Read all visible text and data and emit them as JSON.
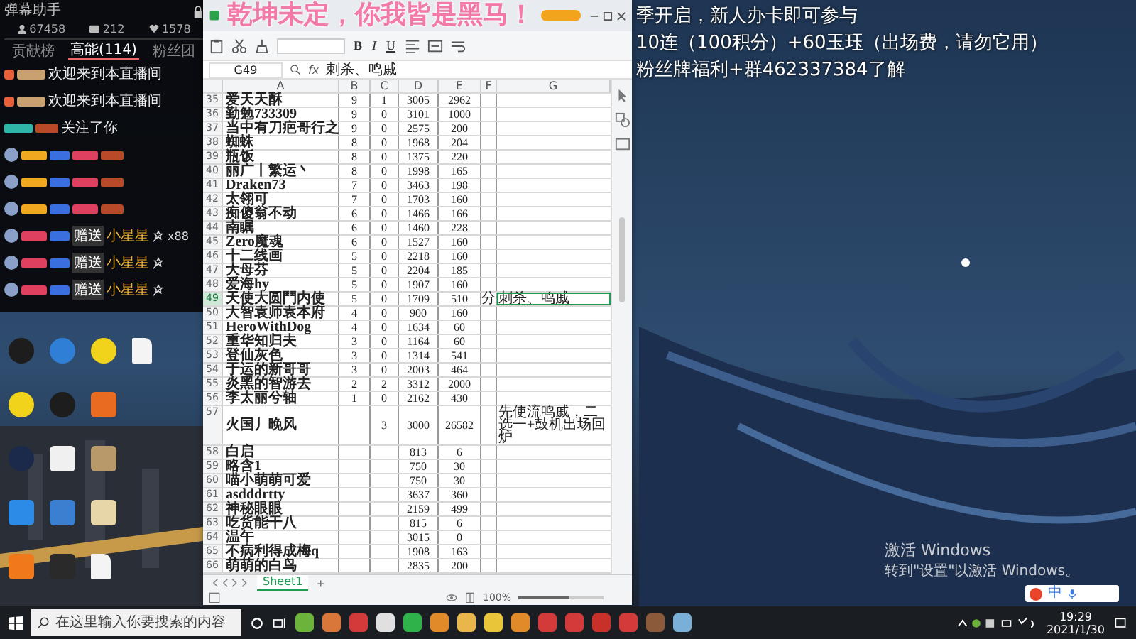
{
  "overlay": {
    "headline": "乾坤未定，你我皆是黑马！",
    "notice_lines": [
      "季开启，新人办卡即可参与",
      "10连（100积分）+60玉珏（出场费，请勿它用）",
      "粉丝牌福利+群462337384了解"
    ]
  },
  "chat": {
    "title": "弹幕助手",
    "stats": [
      {
        "kind": "viewers",
        "value": "67458"
      },
      {
        "kind": "members",
        "value": "212"
      },
      {
        "kind": "likes",
        "value": "1578"
      }
    ],
    "tabs": [
      {
        "label": "贡献榜",
        "selected": false
      },
      {
        "label": "高能(114)",
        "selected": true
      },
      {
        "label": "粉丝团",
        "selected": false
      }
    ],
    "messages": [
      {
        "kind": "welcome",
        "text": "欢迎来到本直播间"
      },
      {
        "kind": "welcome",
        "text": "欢迎来到本直播间"
      },
      {
        "kind": "follow",
        "text": "关注了你"
      },
      {
        "kind": "chat"
      },
      {
        "kind": "chat"
      },
      {
        "kind": "chat"
      },
      {
        "kind": "gift",
        "action": "赠送",
        "item": "小星星",
        "count": "x88"
      },
      {
        "kind": "gift",
        "action": "赠送",
        "item": "小星星"
      },
      {
        "kind": "gift",
        "action": "赠送",
        "item": "小星星"
      }
    ]
  },
  "spreadsheet": {
    "format_buttons": [
      "B",
      "I",
      "U"
    ],
    "name_box": "G49",
    "fx": "fx",
    "formula": "刺杀、鸣戚",
    "columns": [
      "A",
      "B",
      "C",
      "D",
      "E",
      "F",
      "G"
    ],
    "rows": [
      {
        "n": "35",
        "a": "爱天天酥",
        "b": "9",
        "c": "1",
        "d": "3005",
        "e": "2962",
        "selected": false
      },
      {
        "n": "36",
        "a": "勤勉733309",
        "b": "9",
        "c": "0",
        "d": "3101",
        "e": "1000",
        "selected": false
      },
      {
        "n": "37",
        "a": "当中有刀疤哥行之",
        "b": "9",
        "c": "0",
        "d": "2575",
        "e": "200",
        "selected": false
      },
      {
        "n": "38",
        "a": "蜘蛛",
        "b": "8",
        "c": "0",
        "d": "1968",
        "e": "204",
        "selected": false
      },
      {
        "n": "39",
        "a": "瓶饭",
        "b": "8",
        "c": "0",
        "d": "1375",
        "e": "220",
        "selected": false
      },
      {
        "n": "40",
        "a": "丽广丨繁运丶",
        "b": "8",
        "c": "0",
        "d": "1998",
        "e": "165",
        "selected": false
      },
      {
        "n": "41",
        "a": "Draken73",
        "b": "7",
        "c": "0",
        "d": "3463",
        "e": "198",
        "selected": false
      },
      {
        "n": "42",
        "a": "太翎可",
        "b": "7",
        "c": "0",
        "d": "1703",
        "e": "160",
        "selected": false
      },
      {
        "n": "43",
        "a": "痴傻翁不动",
        "b": "6",
        "c": "0",
        "d": "1466",
        "e": "166",
        "selected": false
      },
      {
        "n": "44",
        "a": "南瞩",
        "b": "6",
        "c": "0",
        "d": "1460",
        "e": "228",
        "selected": false
      },
      {
        "n": "45",
        "a": "Zero魔魂",
        "b": "6",
        "c": "0",
        "d": "1527",
        "e": "160",
        "selected": false
      },
      {
        "n": "46",
        "a": "十二线画",
        "b": "5",
        "c": "0",
        "d": "2218",
        "e": "160",
        "selected": false
      },
      {
        "n": "47",
        "a": "大母芬",
        "b": "5",
        "c": "0",
        "d": "2204",
        "e": "185",
        "selected": false
      },
      {
        "n": "48",
        "a": "爱海hy",
        "b": "5",
        "c": "0",
        "d": "1907",
        "e": "160",
        "selected": false
      },
      {
        "n": "49",
        "a": "天使大圆鬥内使",
        "b": "5",
        "c": "0",
        "d": "1709",
        "e": "510",
        "f": "分",
        "g": "刺杀、鸣戚",
        "selected": true
      },
      {
        "n": "50",
        "a": "大智袁师袁本府",
        "b": "4",
        "c": "0",
        "d": "900",
        "e": "160",
        "selected": false
      },
      {
        "n": "51",
        "a": "HeroWithDog",
        "b": "4",
        "c": "0",
        "d": "1634",
        "e": "60",
        "selected": false
      },
      {
        "n": "52",
        "a": "重华知归夫",
        "b": "3",
        "c": "0",
        "d": "1164",
        "e": "60",
        "selected": false
      },
      {
        "n": "53",
        "a": "登仙灰色",
        "b": "3",
        "c": "0",
        "d": "1314",
        "e": "541",
        "selected": false
      },
      {
        "n": "54",
        "a": "于运的新哥哥",
        "b": "3",
        "c": "0",
        "d": "2003",
        "e": "464",
        "selected": false
      },
      {
        "n": "55",
        "a": "炎黑的智游去",
        "b": "2",
        "c": "2",
        "d": "3312",
        "e": "2000",
        "selected": false
      },
      {
        "n": "56",
        "a": "李太丽兮轴",
        "b": "1",
        "c": "0",
        "d": "2162",
        "e": "430",
        "selected": false
      },
      {
        "n": "57",
        "a": "火国丿晚风",
        "c": "3",
        "d": "3000",
        "e": "26582",
        "g": "先使流鸣戚，二选一+鼓机出场回炉",
        "selected": false
      },
      {
        "n": "58",
        "a": "白启",
        "d": "813",
        "e": "6",
        "selected": false
      },
      {
        "n": "59",
        "a": "略含1",
        "d": "750",
        "e": "30",
        "selected": false
      },
      {
        "n": "60",
        "a": "喵小萌萌可爱",
        "d": "750",
        "e": "30",
        "selected": false
      },
      {
        "n": "61",
        "a": "asdddrtty",
        "d": "3637",
        "e": "360",
        "selected": false
      },
      {
        "n": "62",
        "a": "神秘眼眼",
        "d": "2159",
        "e": "499",
        "selected": false
      },
      {
        "n": "63",
        "a": "吃货能干八",
        "d": "815",
        "e": "6",
        "selected": false
      },
      {
        "n": "64",
        "a": "温午",
        "d": "3015",
        "e": "0",
        "selected": false
      },
      {
        "n": "65",
        "a": "不病利得成梅q",
        "d": "1908",
        "e": "163",
        "selected": false
      },
      {
        "n": "66",
        "a": "萌萌的白鸟",
        "d": "2835",
        "e": "200",
        "selected": false
      }
    ],
    "sheet_tabs": [
      {
        "label": "Sheet1",
        "selected": true
      }
    ],
    "add_sheet": "+",
    "zoom": "100%",
    "zoom_slider": {
      "level": 0.6
    }
  },
  "watermark": {
    "title": "激活 Windows",
    "hint": "转到\"设置\"以激活 Windows。"
  },
  "ime": {
    "mode": "中"
  },
  "taskbar": {
    "search_placeholder": "在这里输入你要搜索的内容",
    "time": "19:29",
    "date": "2021/1/30"
  }
}
